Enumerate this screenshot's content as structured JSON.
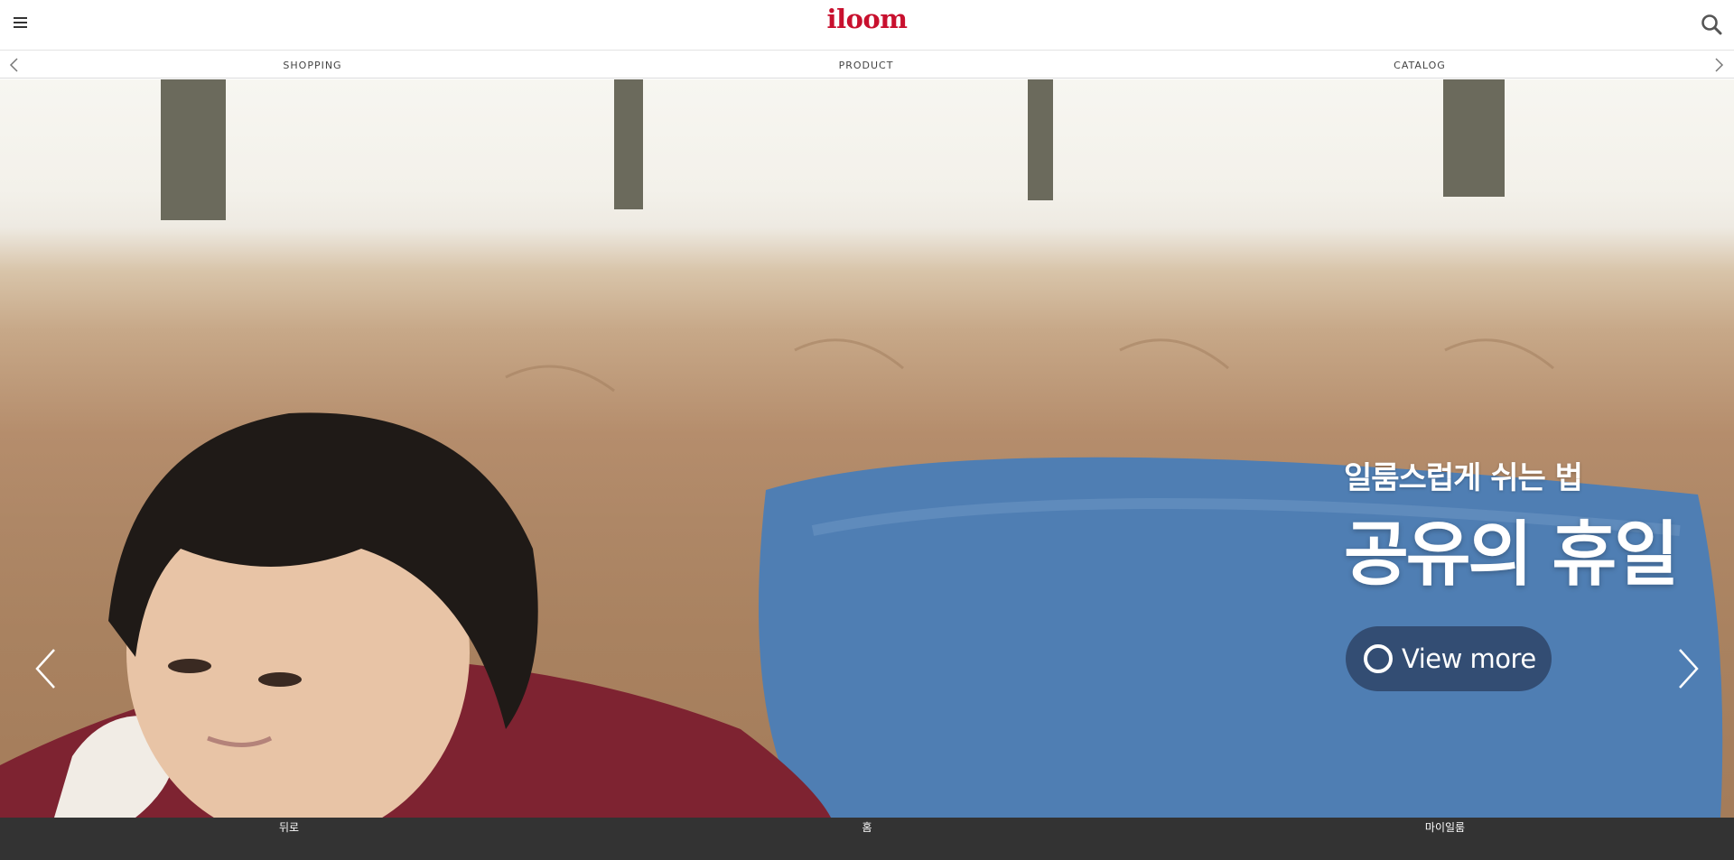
{
  "header": {
    "logo": "iloom",
    "menu_icon": "hamburger-menu-icon",
    "search_icon": "search-icon",
    "brand_color": "#c8102e"
  },
  "subnav": {
    "items": [
      "SHOPPING",
      "PRODUCT",
      "CATALOG"
    ],
    "prev_icon": "chevron-left-icon",
    "next_icon": "chevron-right-icon"
  },
  "hero": {
    "subtitle": "일룸스럽게 쉬는 법",
    "title": "공유의 휴일",
    "button_label": "View more",
    "prev_icon": "slide-prev-icon",
    "next_icon": "slide-next-icon"
  },
  "bottom_bar": {
    "items": [
      "뒤로",
      "홈",
      "마이일룸"
    ],
    "background": "#333333"
  }
}
